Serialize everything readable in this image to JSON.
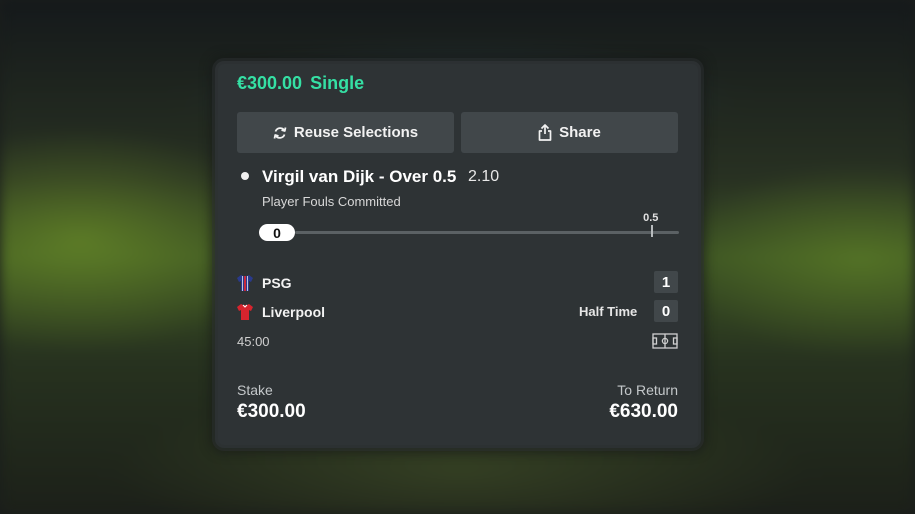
{
  "bet": {
    "stake_amount": "€300.00",
    "bet_type": "Single"
  },
  "actions": {
    "reuse_label": "Reuse Selections",
    "share_label": "Share",
    "reuse_icon": "refresh-icon",
    "share_icon": "share-icon"
  },
  "selection": {
    "title": "Virgil van Dijk - Over 0.5",
    "odds": "2.10",
    "market": "Player Fouls Committed",
    "progress_value": "0",
    "target_value": "0.5",
    "target_fraction": 0.93
  },
  "match": {
    "home_team": "PSG",
    "home_score": "1",
    "away_team": "Liverpool",
    "away_score": "0",
    "period": "Half Time",
    "clock": "45:00",
    "home_icon": "psg-shirt-icon",
    "away_icon": "liverpool-shirt-icon",
    "pitch_icon": "pitch-icon"
  },
  "summary": {
    "stake_label": "Stake",
    "stake_value": "€300.00",
    "return_label": "To Return",
    "return_value": "€630.00"
  },
  "colors": {
    "accent": "#35e0a4",
    "card": "#2e3335",
    "button": "#41474a"
  }
}
